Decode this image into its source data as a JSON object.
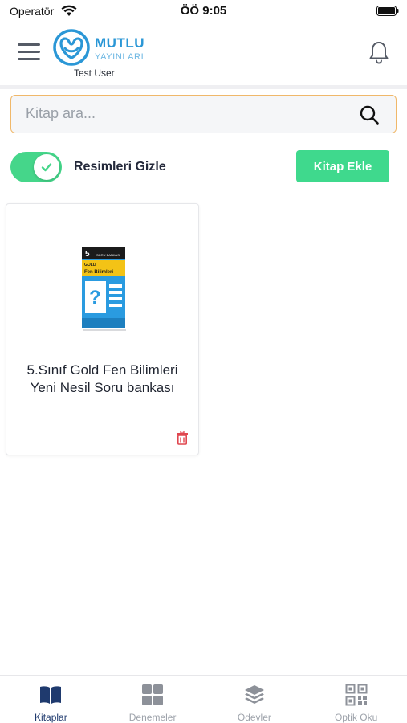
{
  "status_bar": {
    "carrier": "Operatör",
    "time": "ÖÖ 9:05"
  },
  "header": {
    "logo_word1": "MUTLU",
    "logo_word2": "YAYINLARI",
    "user": "Test User"
  },
  "search": {
    "placeholder": "Kitap ara...",
    "value": ""
  },
  "toggle": {
    "label": "Resimleri Gizle",
    "on": true
  },
  "add_book_label": "Kitap Ekle",
  "books": [
    {
      "title": "5.Sınıf Gold Fen Bilimleri Yeni Nesil Soru bankası"
    }
  ],
  "cover": {
    "grade": "5",
    "brand": "GOLD",
    "subject": "Fen Bilimleri",
    "series": "SORU BANKASI"
  },
  "nav": [
    {
      "label": "Kitaplar",
      "icon": "book-icon",
      "active": true
    },
    {
      "label": "Denemeler",
      "icon": "grid-icon",
      "active": false
    },
    {
      "label": "Ödevler",
      "icon": "layers-icon",
      "active": false
    },
    {
      "label": "Optik Oku",
      "icon": "qr-code-icon",
      "active": false
    }
  ],
  "colors": {
    "accent_green": "#3fd98d",
    "brand_blue": "#2b97d6",
    "search_border": "#f0b86a",
    "nav_active": "#1f3a6e",
    "delete_red": "#e0464f"
  }
}
